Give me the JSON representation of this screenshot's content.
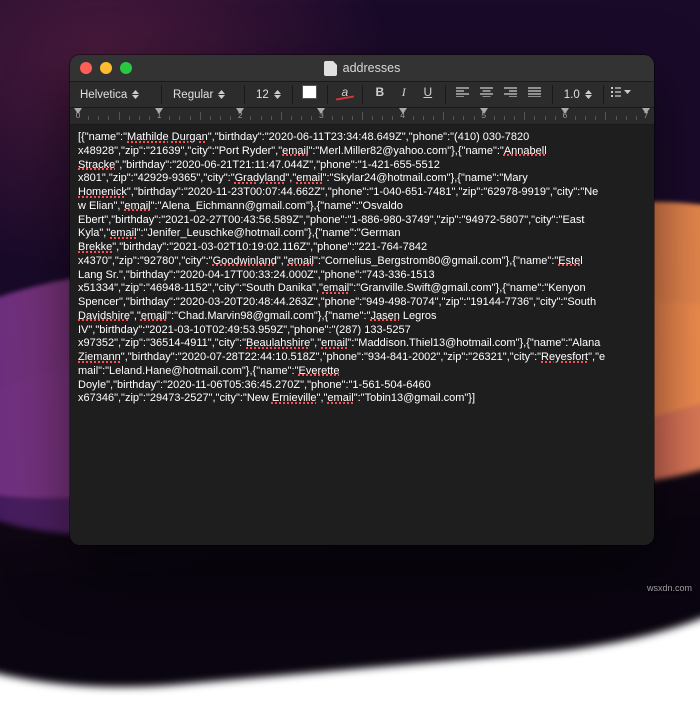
{
  "desktop": {
    "watermark": "wsxdn.com"
  },
  "window": {
    "title": "addresses"
  },
  "toolbar": {
    "font_family": "Helvetica",
    "font_style": "Regular",
    "font_size": "12",
    "line_spacing": "1.0"
  },
  "ruler": {
    "marks": [
      "0",
      "1",
      "2",
      "3",
      "4",
      "5",
      "6",
      "7"
    ]
  },
  "doc": {
    "lines": [
      [
        {
          "t": "[{\"name\":\""
        },
        {
          "t": "Mathilde",
          "m": 1
        },
        {
          "t": " "
        },
        {
          "t": "Durgan",
          "m": 1
        },
        {
          "t": "\",\"birthday\":\"2020-06-11T23:34:48.649Z\",\"phone\":\"(410) 030-7820"
        }
      ],
      [
        {
          "t": "x48928\",\"zip\":\"21639\",\"city\":\"Port Ryder\",\""
        },
        {
          "t": "email",
          "m": 1
        },
        {
          "t": "\":\"Merl.Miller82@yahoo.com\"},{\"name\":\""
        },
        {
          "t": "Annabell",
          "m": 1
        }
      ],
      [
        {
          "t": "Stracke",
          "m": 1
        },
        {
          "t": "\",\"birthday\":\"2020-06-21T21:11:47.044Z\",\"phone\":\"1-421-655-5512"
        }
      ],
      [
        {
          "t": "x801\",\"zip\":\"42929-9365\",\"city\":\""
        },
        {
          "t": "Gradyland",
          "m": 1
        },
        {
          "t": "\",\""
        },
        {
          "t": "email",
          "m": 1
        },
        {
          "t": "\":\"Skylar24@hotmail.com\"},{\"name\":\"Mary"
        }
      ],
      [
        {
          "t": "Homenick",
          "m": 1
        },
        {
          "t": "\",\"birthday\":\"2020-11-23T00:07:44.662Z\",\"phone\":\"1-040-651-7481\",\"zip\":\"62978-9919\",\"city\":\"Ne"
        }
      ],
      [
        {
          "t": "w Elian\",\""
        },
        {
          "t": "email",
          "m": 1
        },
        {
          "t": "\":\"Alena_Eichmann@gmail.com\"},{\"name\":\"Osvaldo"
        }
      ],
      [
        {
          "t": "Ebert\",\"birthday\":\"2021-02-27T00:43:56.589Z\",\"phone\":\"1-886-980-3749\",\"zip\":\"94972-5807\",\"city\":\"East"
        }
      ],
      [
        {
          "t": "Kyla\",\""
        },
        {
          "t": "email",
          "m": 1
        },
        {
          "t": "\":\"Jenifer_Leuschke@hotmail.com\"},{\"name\":\"German"
        }
      ],
      [
        {
          "t": "Brekke",
          "m": 1
        },
        {
          "t": "\",\"birthday\":\"2021-03-02T10:19:02.116Z\",\"phone\":\"221-764-7842"
        }
      ],
      [
        {
          "t": "x4370\",\"zip\":\"92780\",\"city\":\""
        },
        {
          "t": "Goodwinland",
          "m": 1
        },
        {
          "t": "\",\""
        },
        {
          "t": "email",
          "m": 1
        },
        {
          "t": "\":\"Cornelius_Bergstrom80@gmail.com\"},{\"name\":\""
        },
        {
          "t": "Estel",
          "m": 1
        }
      ],
      [
        {
          "t": "Lang Sr.\",\"birthday\":\"2020-04-17T00:33:24.000Z\",\"phone\":\"743-336-1513"
        }
      ],
      [
        {
          "t": "x51334\",\"zip\":\"46948-1152\",\"city\":\"South Danika\",\""
        },
        {
          "t": "email",
          "m": 1
        },
        {
          "t": "\":\"Granville.Swift@gmail.com\"},{\"name\":\"Kenyon"
        }
      ],
      [
        {
          "t": "Spencer\",\"birthday\":\"2020-03-20T20:48:44.263Z\",\"phone\":\"949-498-7074\",\"zip\":\"19144-7736\",\"city\":\"South"
        }
      ],
      [
        {
          "t": "Davidshire",
          "m": 1
        },
        {
          "t": "\",\""
        },
        {
          "t": "email",
          "m": 1
        },
        {
          "t": "\":\"Chad.Marvin98@gmail.com\"},{\"name\":\""
        },
        {
          "t": "Jasen",
          "m": 1
        },
        {
          "t": " Legros"
        }
      ],
      [
        {
          "t": "IV\",\"birthday\":\"2021-03-10T02:49:53.959Z\",\"phone\":\"(287) 133-5257"
        }
      ],
      [
        {
          "t": "x97352\",\"zip\":\"36514-4911\",\"city\":\""
        },
        {
          "t": "Beaulahshire",
          "m": 1
        },
        {
          "t": "\",\""
        },
        {
          "t": "email",
          "m": 1
        },
        {
          "t": "\":\"Maddison.Thiel13@hotmail.com\"},{\"name\":\"Alana"
        }
      ],
      [
        {
          "t": "Ziemann",
          "m": 1
        },
        {
          "t": "\",\"birthday\":\"2020-07-28T22:44:10.518Z\",\"phone\":\"934-841-2002\",\"zip\":\"26321\",\"city\":\""
        },
        {
          "t": "Reyesfort",
          "m": 1
        },
        {
          "t": "\",\"e"
        }
      ],
      [
        {
          "t": "mail\":\"Leland.Hane@hotmail.com\"},{\"name\":\""
        },
        {
          "t": "Everette",
          "m": 1
        }
      ],
      [
        {
          "t": "Doyle\",\"birthday\":\"2020-11-06T05:36:45.270Z\",\"phone\":\"1-561-504-6460"
        }
      ],
      [
        {
          "t": "x67346\",\"zip\":\"29473-2527\",\"city\":\"New "
        },
        {
          "t": "Ernieville",
          "m": 1
        },
        {
          "t": "\",\""
        },
        {
          "t": "email",
          "m": 1
        },
        {
          "t": "\":\"Tobin13@gmail.com\"}]"
        }
      ]
    ]
  }
}
